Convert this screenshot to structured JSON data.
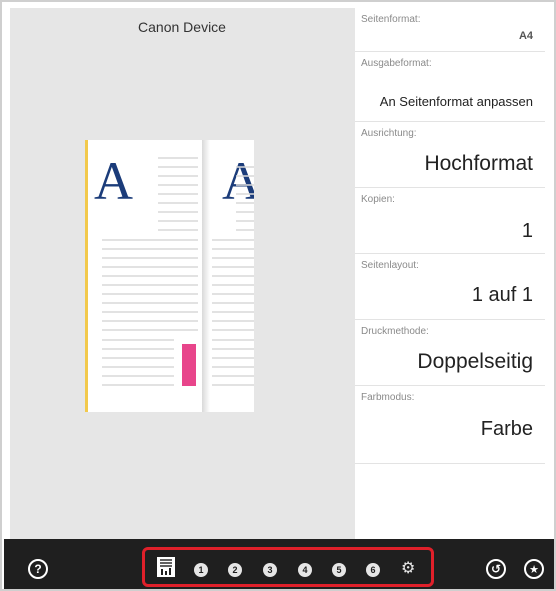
{
  "preview": {
    "device_title": "Canon Device",
    "sample_letter": "A"
  },
  "settings": [
    {
      "label": "Seitenformat:",
      "value": "A4"
    },
    {
      "label": "Ausgabeformat:",
      "value": "An Seitenformat anpassen"
    },
    {
      "label": "Ausrichtung:",
      "value": "Hochformat"
    },
    {
      "label": "Kopien:",
      "value": "1"
    },
    {
      "label": "Seitenlayout:",
      "value": "1 auf 1"
    },
    {
      "label": "Druckmethode:",
      "value": "Doppelseitig"
    },
    {
      "label": "Farbmodus:",
      "value": "Farbe"
    }
  ],
  "bottombar": {
    "help_icon": "help-icon",
    "nav_numbers": [
      "1",
      "2",
      "3",
      "4",
      "5",
      "6"
    ],
    "gear_icon": "gear-icon",
    "reset_icon": "reset-icon",
    "favorite_icon": "favorite-icon"
  },
  "colors": {
    "accent_pink": "#e8458b",
    "page_edge_yellow": "#f2c94c",
    "letter_blue": "#1b3c7a",
    "highlight_red": "#e0202a",
    "bottombar_bg": "#1f1f1f"
  }
}
